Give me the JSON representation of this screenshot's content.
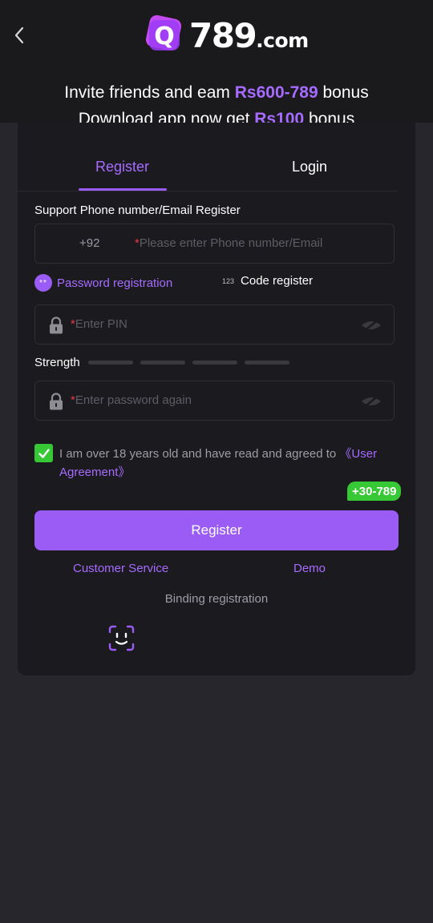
{
  "header": {
    "logo_text": "789",
    "logo_domain": ".com",
    "logo_letter": "Q"
  },
  "promo": {
    "line1_pre": "Invite friends and eam ",
    "line1_hl": "Rs600-789",
    "line1_post": " bonus",
    "line2_pre": "Download app now get ",
    "line2_hl": "Rs100",
    "line2_post": " bonus"
  },
  "tabs": {
    "register": "Register",
    "login": "Login"
  },
  "form": {
    "support_label": "Support Phone number/Email Register",
    "country_code": "+92",
    "required_mark": "*",
    "phone_placeholder": "Please enter Phone number/Email",
    "mode_password_dots": "**",
    "mode_password": "Password registration",
    "mode_code_digits": "123",
    "mode_code": "Code register",
    "pin_placeholder": "Enter PIN",
    "strength_label": "Strength",
    "strength_level": 0,
    "confirm_placeholder": "Enter password again",
    "agree_text": "I am over 18 years old and have read and agreed to ",
    "agree_link": "《User Agreement》",
    "agree_checked": true,
    "bonus_badge": "+30-789",
    "register_button": "Register"
  },
  "footer": {
    "customer_service": "Customer Service",
    "demo": "Demo",
    "binding": "Binding registration"
  },
  "icons": {
    "back": "chevron-left-icon",
    "lock": "lock-icon",
    "eye": "eye-off-icon",
    "face": "face-scan-icon"
  },
  "colors": {
    "accent": "#9b5cf6",
    "accent_text": "#a66bff",
    "success": "#37c935",
    "background": "#28262d",
    "card": "#1b1a1e"
  }
}
